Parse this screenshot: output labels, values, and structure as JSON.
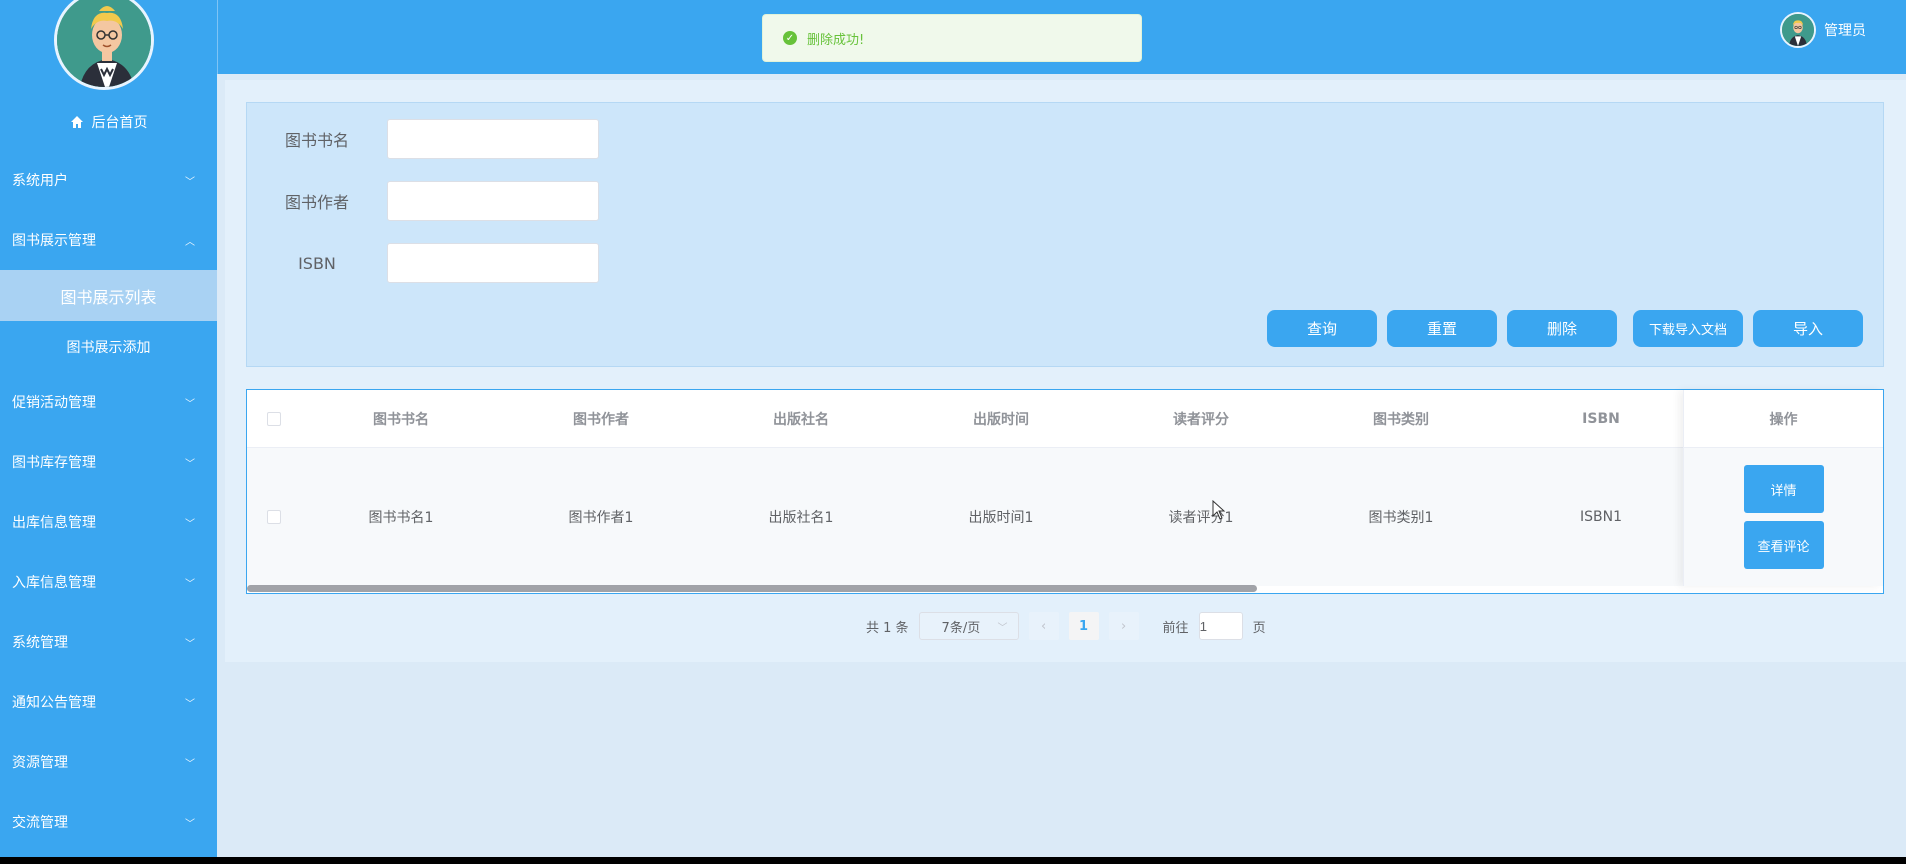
{
  "sidebar": {
    "home_label": "后台首页",
    "items": [
      {
        "label": "系统用户",
        "expanded": false
      },
      {
        "label": "图书展示管理",
        "expanded": true
      },
      {
        "label": "促销活动管理",
        "expanded": false
      },
      {
        "label": "图书库存管理",
        "expanded": false
      },
      {
        "label": "出库信息管理",
        "expanded": false
      },
      {
        "label": "入库信息管理",
        "expanded": false
      },
      {
        "label": "系统管理",
        "expanded": false
      },
      {
        "label": "通知公告管理",
        "expanded": false
      },
      {
        "label": "资源管理",
        "expanded": false
      },
      {
        "label": "交流管理",
        "expanded": false
      }
    ],
    "subitems": [
      {
        "label": "图书展示列表",
        "active": true
      },
      {
        "label": "图书展示添加",
        "active": false
      }
    ]
  },
  "header": {
    "user_name": "管理员",
    "toast_message": "删除成功!"
  },
  "search": {
    "fields": [
      {
        "label": "图书书名",
        "value": ""
      },
      {
        "label": "图书作者",
        "value": ""
      },
      {
        "label": "ISBN",
        "value": ""
      }
    ],
    "buttons": {
      "query": "查询",
      "reset": "重置",
      "delete": "删除",
      "download_template": "下载导入文档",
      "import": "导入"
    }
  },
  "table": {
    "columns": [
      "图书书名",
      "图书作者",
      "出版社名",
      "出版时间",
      "读者评分",
      "图书类别",
      "ISBN"
    ],
    "ops_header": "操作",
    "rows": [
      [
        "图书书名1",
        "图书作者1",
        "出版社名1",
        "出版时间1",
        "读者评分1",
        "图书类别1",
        "ISBN1"
      ]
    ],
    "row_actions": {
      "detail": "详情",
      "comments": "查看评论"
    }
  },
  "pagination": {
    "total_text": "共 1 条",
    "page_size": "7条/页",
    "current_page": "1",
    "goto_prefix": "前往",
    "goto_value": "1",
    "goto_suffix": "页"
  },
  "colors": {
    "primary": "#3aa6f0",
    "success": "#67c23a"
  }
}
